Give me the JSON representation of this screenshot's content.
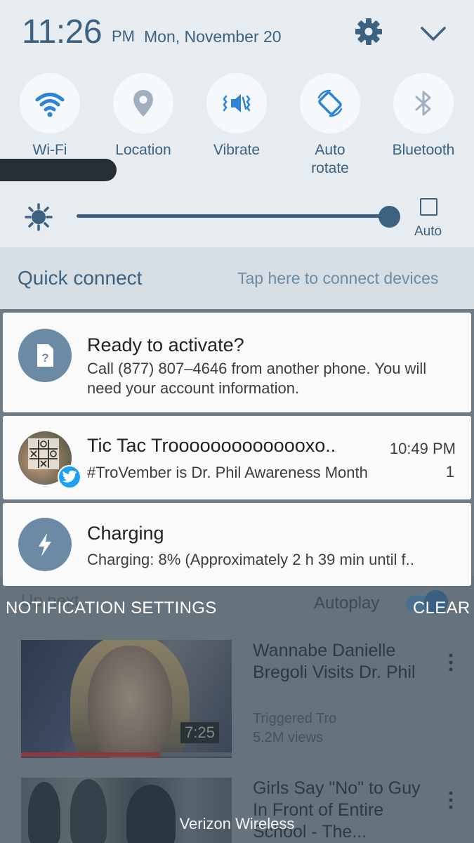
{
  "status": {
    "time": "11:26",
    "ampm": "PM",
    "date": "Mon, November 20"
  },
  "header_icons": [
    "gear-icon",
    "chevron-down-icon"
  ],
  "quick_toggles": [
    {
      "label": "Wi-Fi",
      "icon": "wifi-icon",
      "active": true
    },
    {
      "label": "Location",
      "icon": "location-pin-icon",
      "active": false
    },
    {
      "label": "Vibrate",
      "icon": "vibrate-icon",
      "active": true
    },
    {
      "label": "Auto\nrotate",
      "icon": "auto-rotate-icon",
      "active": true
    },
    {
      "label": "Bluetooth",
      "icon": "bluetooth-icon",
      "active": false
    }
  ],
  "brightness": {
    "level": 1.0,
    "auto_label": "Auto",
    "auto_checked": false
  },
  "quick_connect": {
    "title": "Quick connect",
    "hint": "Tap here to connect devices"
  },
  "notifications": [
    {
      "title": "Ready to activate?",
      "body": "Call (877) 807–4646 from another phone. You will need your account information.",
      "icon": "sim-card-icon"
    },
    {
      "title": "Tic Tac Troooooooooooooxo..",
      "time": "10:49 PM",
      "body": "#TroVember is Dr. Phil Awareness Month",
      "count": "1",
      "icon": "twitter-icon"
    },
    {
      "title": "Charging",
      "body": "Charging: 8% (Approximately 2 h 39 min until f..",
      "icon": "lightning-icon"
    }
  ],
  "actions": {
    "settings": "NOTIFICATION SETTINGS",
    "clear": "CLEAR"
  },
  "background_app": {
    "up_next": "Up next",
    "autoplay": "Autoplay",
    "videos": [
      {
        "title": "Wannabe Danielle Bregoli Visits Dr. Phil",
        "channel": "Triggered Tro",
        "views": "5.2M views",
        "duration": "7:25",
        "watched_fraction": 0.66
      },
      {
        "title": "Girls Say \"No\" to Guy In Front of Entire School - The..."
      }
    ]
  },
  "carrier": "Verizon Wireless",
  "colors": {
    "accent": "#3d6181",
    "shade_bg": "#e6ecf0",
    "card_bg": "#fafafa",
    "twitter": "#1da1f2"
  }
}
